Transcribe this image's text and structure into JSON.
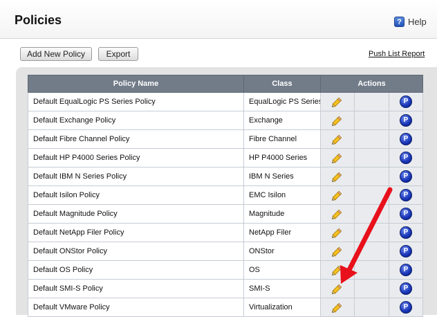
{
  "header": {
    "title": "Policies",
    "help_label": "Help",
    "help_icon": "question-icon",
    "help_glyph": "?"
  },
  "toolbar": {
    "add_label": "Add New Policy",
    "export_label": "Export",
    "push_list_label": "Push List Report"
  },
  "table": {
    "columns": [
      "Policy Name",
      "Class",
      "Actions"
    ],
    "edit_icon": "pencil-icon",
    "push_icon": "push-icon",
    "push_glyph": "P",
    "rows": [
      {
        "name": "Default EqualLogic PS Series Policy",
        "class": "EqualLogic PS Series"
      },
      {
        "name": "Default Exchange Policy",
        "class": "Exchange"
      },
      {
        "name": "Default Fibre Channel Policy",
        "class": "Fibre Channel"
      },
      {
        "name": "Default HP P4000 Series Policy",
        "class": "HP P4000 Series"
      },
      {
        "name": "Default IBM N Series Policy",
        "class": "IBM N Series"
      },
      {
        "name": "Default Isilon Policy",
        "class": "EMC Isilon"
      },
      {
        "name": "Default Magnitude Policy",
        "class": "Magnitude"
      },
      {
        "name": "Default NetApp Filer Policy",
        "class": "NetApp Filer"
      },
      {
        "name": "Default ONStor Policy",
        "class": "ONStor"
      },
      {
        "name": "Default OS Policy",
        "class": "OS"
      },
      {
        "name": "Default SMI-S Policy",
        "class": "SMI-S"
      },
      {
        "name": "Default VMware Policy",
        "class": "Virtualization"
      }
    ]
  },
  "annotation": {
    "arrow_color": "#e8101b"
  }
}
